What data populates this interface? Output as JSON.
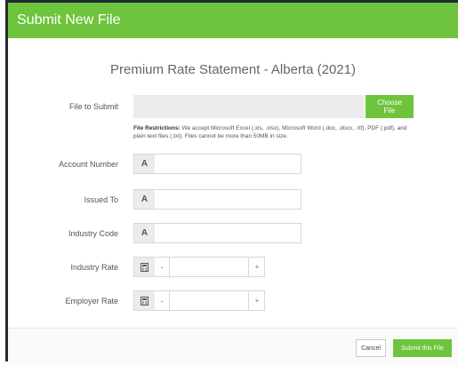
{
  "modal": {
    "header_title": "Submit New File",
    "document_title": "Premium Rate Statement - Alberta (2021)"
  },
  "file": {
    "label": "File to Submit",
    "choose_label": "Choose File",
    "restrictions_heading": "File Restrictions:",
    "restrictions_text": "We accept Microsoft Excel (.xls, .xlsx), Microsoft Word (.doc, .docx, .rtf), PDF (.pdf), and plain text files (.txt). Files cannot be more than 50MB in size."
  },
  "fields": {
    "account_number": {
      "label": "Account Number",
      "icon": "A",
      "value": ""
    },
    "issued_to": {
      "label": "Issued To",
      "icon": "A",
      "value": ""
    },
    "industry_code": {
      "label": "Industry Code",
      "icon": "A",
      "value": ""
    },
    "industry_rate": {
      "label": "Industry Rate",
      "minus": "-",
      "plus": "+",
      "value": ""
    },
    "employer_rate": {
      "label": "Employer Rate",
      "minus": "-",
      "plus": "+",
      "value": ""
    }
  },
  "footer": {
    "cancel_label": "Cancel",
    "submit_label": "Submit this File"
  },
  "colors": {
    "accent": "#6ec43c"
  }
}
